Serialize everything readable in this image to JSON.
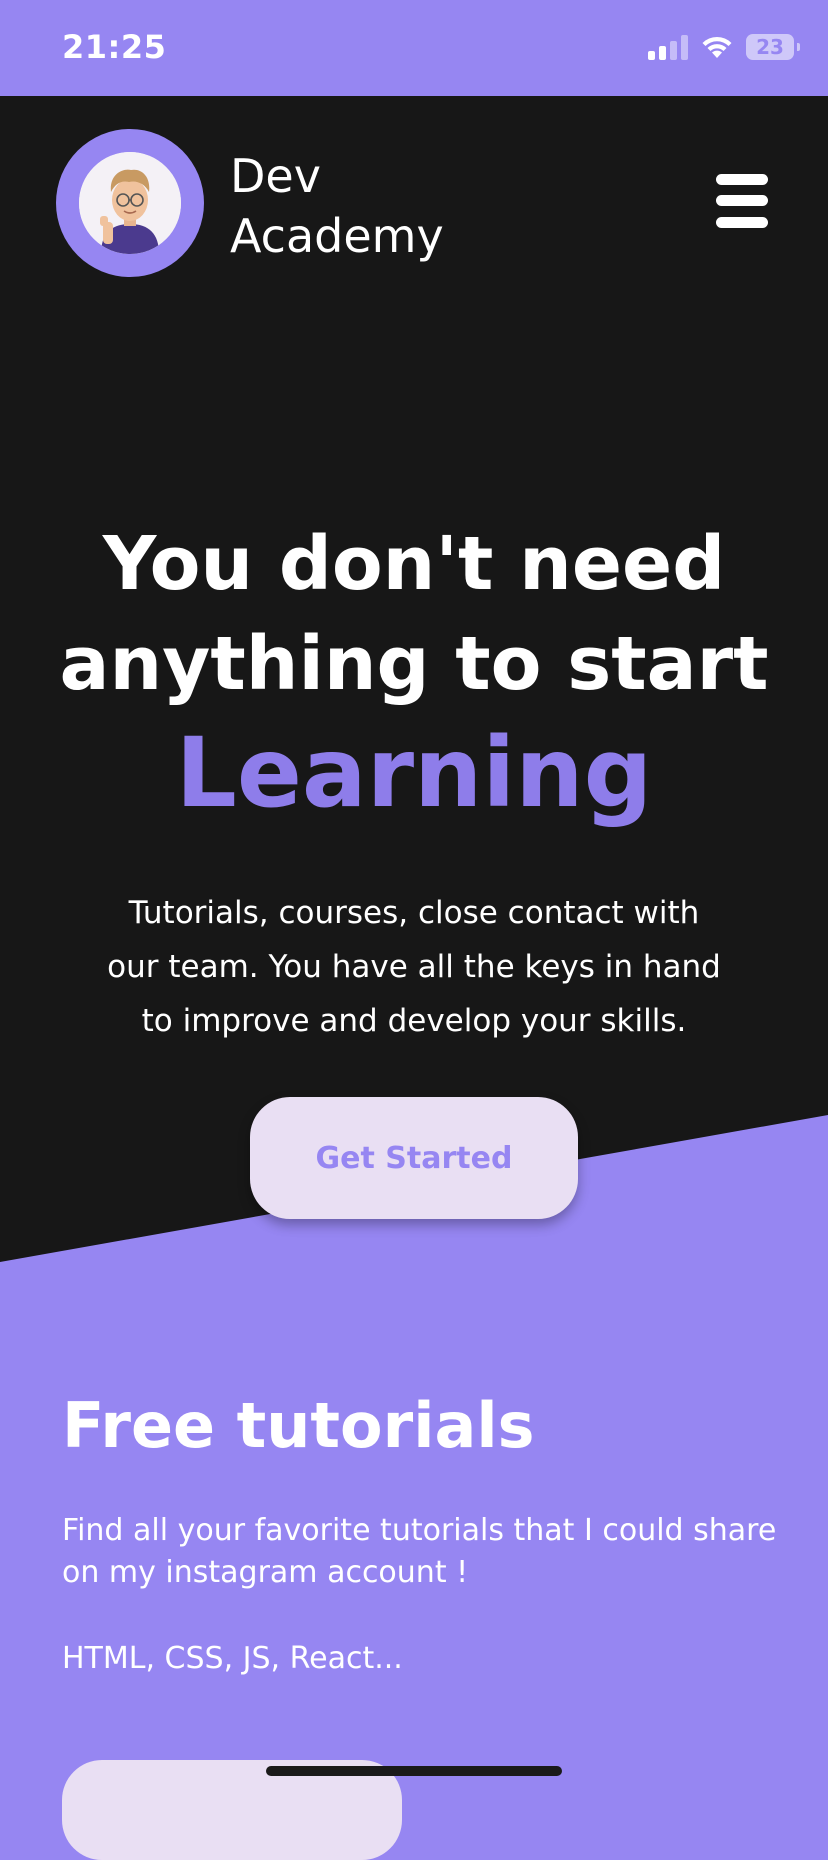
{
  "status_bar": {
    "time": "21:25",
    "battery": "23"
  },
  "header": {
    "brand_line1": "Dev",
    "brand_line2": "Academy",
    "avatar_icon": "memoji-avatar-icon",
    "menu_icon": "hamburger-menu-icon"
  },
  "hero": {
    "title_line1": "You don't need",
    "title_line2": "anything to start",
    "highlight": "Learning",
    "description_lines": [
      "Tutorials, courses, close contact with",
      "our team. You have all the keys in hand",
      "to improve and develop your skills."
    ],
    "cta_label": "Get Started"
  },
  "tutorials": {
    "title": "Free tutorials",
    "description": "Find all your favorite tutorials that I could share on my instagram account !",
    "tags": "HTML, CSS, JS, React..."
  },
  "colors": {
    "accent": "#9686F2",
    "highlight": "#8E7DEA",
    "dark_bg": "#171717",
    "button_bg": "#E9DFF3"
  }
}
